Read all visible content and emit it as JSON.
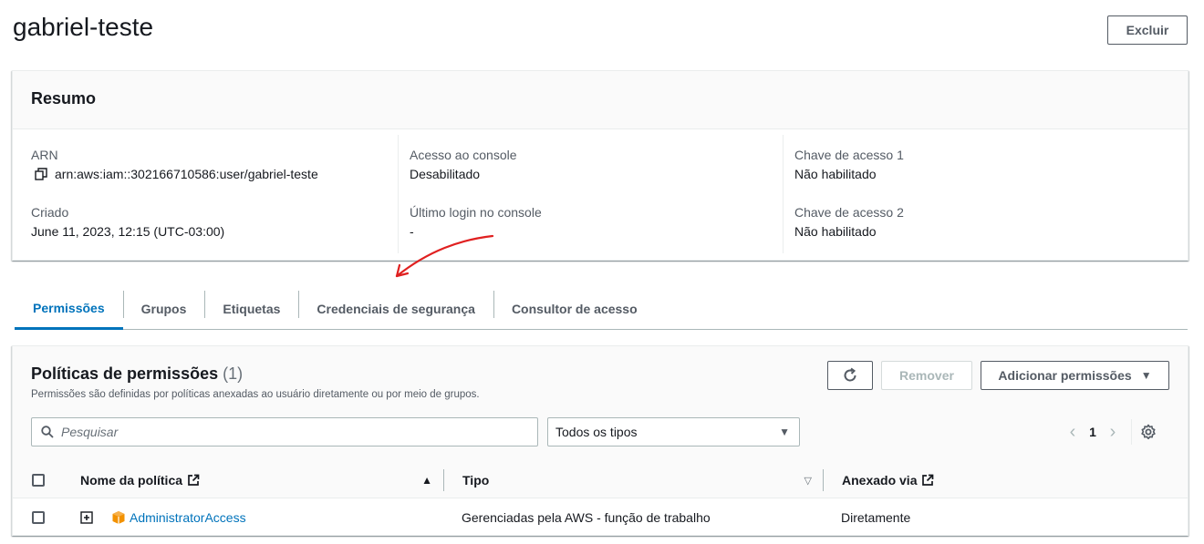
{
  "page": {
    "title": "gabriel-teste",
    "delete_label": "Excluir"
  },
  "summary": {
    "heading": "Resumo",
    "arn_label": "ARN",
    "arn_value": "arn:aws:iam::302166710586:user/gabriel-teste",
    "created_label": "Criado",
    "created_value": "June 11, 2023, 12:15 (UTC-03:00)",
    "console_access_label": "Acesso ao console",
    "console_access_value": "Desabilitado",
    "last_login_label": "Último login no console",
    "last_login_value": "-",
    "access_key1_label": "Chave de acesso 1",
    "access_key1_value": "Não habilitado",
    "access_key2_label": "Chave de acesso 2",
    "access_key2_value": "Não habilitado"
  },
  "tabs": [
    {
      "label": "Permissões",
      "active": true
    },
    {
      "label": "Grupos"
    },
    {
      "label": "Etiquetas"
    },
    {
      "label": "Credenciais de segurança"
    },
    {
      "label": "Consultor de acesso"
    }
  ],
  "policies": {
    "title": "Políticas de permissões",
    "count": "(1)",
    "description": "Permissões são definidas por políticas anexadas ao usuário diretamente ou por meio de grupos.",
    "remove_label": "Remover",
    "add_label": "Adicionar permissões",
    "search_placeholder": "Pesquisar",
    "filter_value": "Todos os tipos",
    "page_number": "1",
    "columns": {
      "name": "Nome da política",
      "type": "Tipo",
      "attached": "Anexado via"
    },
    "rows": [
      {
        "name": "AdministratorAccess",
        "type": "Gerenciadas pela AWS - função de trabalho",
        "attached": "Diretamente"
      }
    ]
  },
  "colors": {
    "accent": "#0073bb",
    "annotation": "#e02020",
    "policy_icon": "#f29100"
  }
}
